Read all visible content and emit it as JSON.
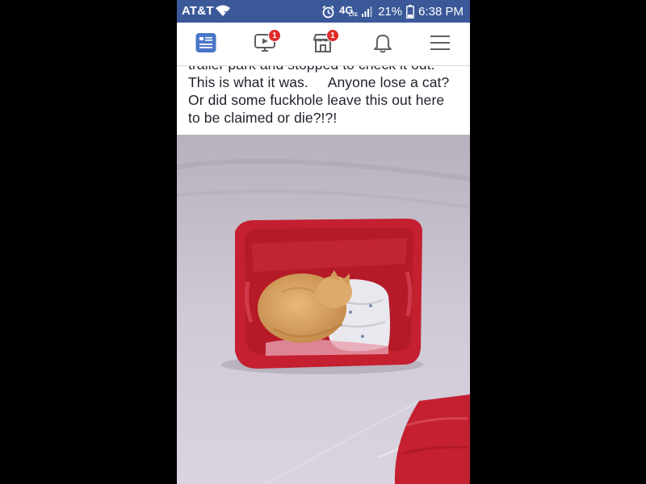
{
  "status_bar": {
    "carrier": "AT&T",
    "network_type": "4G",
    "network_sub": "LTE",
    "battery_percent": "21%",
    "time": "6:38 PM"
  },
  "nav": {
    "items": [
      {
        "name": "news-feed",
        "icon": "news-feed-icon",
        "active": true
      },
      {
        "name": "watch",
        "icon": "video-icon",
        "badge": "1"
      },
      {
        "name": "marketplace",
        "icon": "marketplace-icon",
        "badge": "1"
      },
      {
        "name": "notifications",
        "icon": "bell-icon"
      },
      {
        "name": "menu",
        "icon": "hamburger-menu-icon"
      }
    ]
  },
  "post": {
    "lines": [
      "trailer park and stopped to check it out.",
      "This is what it was.     Anyone lose a cat?",
      "Or did some fuckhole leave this out here",
      "to be claimed or die?!?!"
    ]
  },
  "colors": {
    "status_bar_bg": "#3b5998",
    "nav_active": "#4a76c8",
    "badge_bg": "#e02a2a",
    "bin_red": "#c42030"
  }
}
